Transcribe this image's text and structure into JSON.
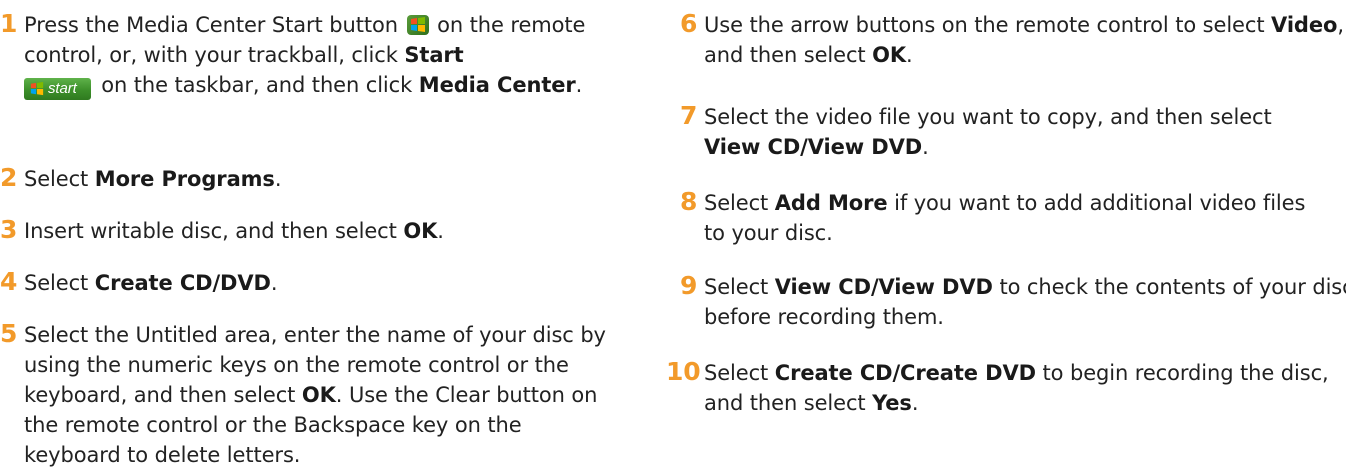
{
  "left_steps": [
    {
      "num": "1",
      "a": "Press the Media Center Start button",
      "b": "on the remote control, or, with your trackball, click",
      "bold1": "Start",
      "c": "on the taskbar, and then click",
      "bold2": "Media Center",
      "d": ".",
      "start_btn_label": "start"
    },
    {
      "num": "2",
      "text": "Select",
      "bold": "More Programs",
      "end": "."
    },
    {
      "num": "3",
      "text": "Insert writable disc, and then select",
      "bold": "OK",
      "end": "."
    },
    {
      "num": "4",
      "text": "Select",
      "bold": "Create CD/DVD",
      "end": "."
    },
    {
      "num": "5",
      "a": "Select the Untitled area, enter the name of your disc by using the numeric keys on the remote control or the keyboard, and then select",
      "bold": "OK",
      "b": ". Use the Clear button on the remote control or the Backspace key on the keyboard to delete letters."
    }
  ],
  "right_steps": [
    {
      "num": "6",
      "a": "Use the arrow buttons on the remote control to select",
      "bold1": "Video",
      "b": ", and then select",
      "bold2": "OK",
      "c": "."
    },
    {
      "num": "7",
      "a": "Select the video file you want to copy, and then select",
      "bold": "View CD/View DVD",
      "b": "."
    },
    {
      "num": "8",
      "a": "Select",
      "bold": "Add More",
      "b": "if you want to add additional video files to your disc."
    },
    {
      "num": "9",
      "a": "Select",
      "bold": "View CD/View DVD",
      "b": "to check the contents of your disc before recording them."
    },
    {
      "num": "10",
      "a": "Select",
      "bold1": "Create CD/Create DVD",
      "b": "to begin recording the disc, and then select",
      "bold2": "Yes",
      "c": "."
    }
  ],
  "colors": {
    "step_number": "#f29a2a",
    "start_button": "#3c8f2a"
  },
  "icons": {
    "media_center_button": "windows-logo-icon",
    "start_button": "windows-start-button-icon"
  }
}
